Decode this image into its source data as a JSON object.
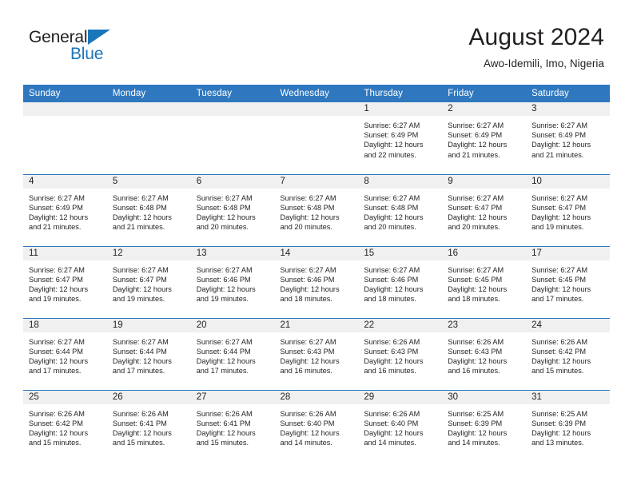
{
  "brand": {
    "name_top": "General",
    "name_bottom": "Blue",
    "triangle_color": "#1b75bb"
  },
  "header": {
    "title": "August 2024",
    "subtitle": "Awo-Idemili, Imo, Nigeria",
    "accent_color": "#2f78bf"
  },
  "weekday_headers": [
    "Sunday",
    "Monday",
    "Tuesday",
    "Wednesday",
    "Thursday",
    "Friday",
    "Saturday"
  ],
  "weeks": [
    [
      {
        "day": "",
        "blank": true,
        "sunrise": "",
        "sunset": "",
        "daylight1": "",
        "daylight2": ""
      },
      {
        "day": "",
        "blank": true,
        "sunrise": "",
        "sunset": "",
        "daylight1": "",
        "daylight2": ""
      },
      {
        "day": "",
        "blank": true,
        "sunrise": "",
        "sunset": "",
        "daylight1": "",
        "daylight2": ""
      },
      {
        "day": "",
        "blank": true,
        "sunrise": "",
        "sunset": "",
        "daylight1": "",
        "daylight2": ""
      },
      {
        "day": "1",
        "blank": false,
        "sunrise": "Sunrise: 6:27 AM",
        "sunset": "Sunset: 6:49 PM",
        "daylight1": "Daylight: 12 hours",
        "daylight2": "and 22 minutes."
      },
      {
        "day": "2",
        "blank": false,
        "sunrise": "Sunrise: 6:27 AM",
        "sunset": "Sunset: 6:49 PM",
        "daylight1": "Daylight: 12 hours",
        "daylight2": "and 21 minutes."
      },
      {
        "day": "3",
        "blank": false,
        "sunrise": "Sunrise: 6:27 AM",
        "sunset": "Sunset: 6:49 PM",
        "daylight1": "Daylight: 12 hours",
        "daylight2": "and 21 minutes."
      }
    ],
    [
      {
        "day": "4",
        "blank": false,
        "sunrise": "Sunrise: 6:27 AM",
        "sunset": "Sunset: 6:49 PM",
        "daylight1": "Daylight: 12 hours",
        "daylight2": "and 21 minutes."
      },
      {
        "day": "5",
        "blank": false,
        "sunrise": "Sunrise: 6:27 AM",
        "sunset": "Sunset: 6:48 PM",
        "daylight1": "Daylight: 12 hours",
        "daylight2": "and 21 minutes."
      },
      {
        "day": "6",
        "blank": false,
        "sunrise": "Sunrise: 6:27 AM",
        "sunset": "Sunset: 6:48 PM",
        "daylight1": "Daylight: 12 hours",
        "daylight2": "and 20 minutes."
      },
      {
        "day": "7",
        "blank": false,
        "sunrise": "Sunrise: 6:27 AM",
        "sunset": "Sunset: 6:48 PM",
        "daylight1": "Daylight: 12 hours",
        "daylight2": "and 20 minutes."
      },
      {
        "day": "8",
        "blank": false,
        "sunrise": "Sunrise: 6:27 AM",
        "sunset": "Sunset: 6:48 PM",
        "daylight1": "Daylight: 12 hours",
        "daylight2": "and 20 minutes."
      },
      {
        "day": "9",
        "blank": false,
        "sunrise": "Sunrise: 6:27 AM",
        "sunset": "Sunset: 6:47 PM",
        "daylight1": "Daylight: 12 hours",
        "daylight2": "and 20 minutes."
      },
      {
        "day": "10",
        "blank": false,
        "sunrise": "Sunrise: 6:27 AM",
        "sunset": "Sunset: 6:47 PM",
        "daylight1": "Daylight: 12 hours",
        "daylight2": "and 19 minutes."
      }
    ],
    [
      {
        "day": "11",
        "blank": false,
        "sunrise": "Sunrise: 6:27 AM",
        "sunset": "Sunset: 6:47 PM",
        "daylight1": "Daylight: 12 hours",
        "daylight2": "and 19 minutes."
      },
      {
        "day": "12",
        "blank": false,
        "sunrise": "Sunrise: 6:27 AM",
        "sunset": "Sunset: 6:47 PM",
        "daylight1": "Daylight: 12 hours",
        "daylight2": "and 19 minutes."
      },
      {
        "day": "13",
        "blank": false,
        "sunrise": "Sunrise: 6:27 AM",
        "sunset": "Sunset: 6:46 PM",
        "daylight1": "Daylight: 12 hours",
        "daylight2": "and 19 minutes."
      },
      {
        "day": "14",
        "blank": false,
        "sunrise": "Sunrise: 6:27 AM",
        "sunset": "Sunset: 6:46 PM",
        "daylight1": "Daylight: 12 hours",
        "daylight2": "and 18 minutes."
      },
      {
        "day": "15",
        "blank": false,
        "sunrise": "Sunrise: 6:27 AM",
        "sunset": "Sunset: 6:46 PM",
        "daylight1": "Daylight: 12 hours",
        "daylight2": "and 18 minutes."
      },
      {
        "day": "16",
        "blank": false,
        "sunrise": "Sunrise: 6:27 AM",
        "sunset": "Sunset: 6:45 PM",
        "daylight1": "Daylight: 12 hours",
        "daylight2": "and 18 minutes."
      },
      {
        "day": "17",
        "blank": false,
        "sunrise": "Sunrise: 6:27 AM",
        "sunset": "Sunset: 6:45 PM",
        "daylight1": "Daylight: 12 hours",
        "daylight2": "and 17 minutes."
      }
    ],
    [
      {
        "day": "18",
        "blank": false,
        "sunrise": "Sunrise: 6:27 AM",
        "sunset": "Sunset: 6:44 PM",
        "daylight1": "Daylight: 12 hours",
        "daylight2": "and 17 minutes."
      },
      {
        "day": "19",
        "blank": false,
        "sunrise": "Sunrise: 6:27 AM",
        "sunset": "Sunset: 6:44 PM",
        "daylight1": "Daylight: 12 hours",
        "daylight2": "and 17 minutes."
      },
      {
        "day": "20",
        "blank": false,
        "sunrise": "Sunrise: 6:27 AM",
        "sunset": "Sunset: 6:44 PM",
        "daylight1": "Daylight: 12 hours",
        "daylight2": "and 17 minutes."
      },
      {
        "day": "21",
        "blank": false,
        "sunrise": "Sunrise: 6:27 AM",
        "sunset": "Sunset: 6:43 PM",
        "daylight1": "Daylight: 12 hours",
        "daylight2": "and 16 minutes."
      },
      {
        "day": "22",
        "blank": false,
        "sunrise": "Sunrise: 6:26 AM",
        "sunset": "Sunset: 6:43 PM",
        "daylight1": "Daylight: 12 hours",
        "daylight2": "and 16 minutes."
      },
      {
        "day": "23",
        "blank": false,
        "sunrise": "Sunrise: 6:26 AM",
        "sunset": "Sunset: 6:43 PM",
        "daylight1": "Daylight: 12 hours",
        "daylight2": "and 16 minutes."
      },
      {
        "day": "24",
        "blank": false,
        "sunrise": "Sunrise: 6:26 AM",
        "sunset": "Sunset: 6:42 PM",
        "daylight1": "Daylight: 12 hours",
        "daylight2": "and 15 minutes."
      }
    ],
    [
      {
        "day": "25",
        "blank": false,
        "sunrise": "Sunrise: 6:26 AM",
        "sunset": "Sunset: 6:42 PM",
        "daylight1": "Daylight: 12 hours",
        "daylight2": "and 15 minutes."
      },
      {
        "day": "26",
        "blank": false,
        "sunrise": "Sunrise: 6:26 AM",
        "sunset": "Sunset: 6:41 PM",
        "daylight1": "Daylight: 12 hours",
        "daylight2": "and 15 minutes."
      },
      {
        "day": "27",
        "blank": false,
        "sunrise": "Sunrise: 6:26 AM",
        "sunset": "Sunset: 6:41 PM",
        "daylight1": "Daylight: 12 hours",
        "daylight2": "and 15 minutes."
      },
      {
        "day": "28",
        "blank": false,
        "sunrise": "Sunrise: 6:26 AM",
        "sunset": "Sunset: 6:40 PM",
        "daylight1": "Daylight: 12 hours",
        "daylight2": "and 14 minutes."
      },
      {
        "day": "29",
        "blank": false,
        "sunrise": "Sunrise: 6:26 AM",
        "sunset": "Sunset: 6:40 PM",
        "daylight1": "Daylight: 12 hours",
        "daylight2": "and 14 minutes."
      },
      {
        "day": "30",
        "blank": false,
        "sunrise": "Sunrise: 6:25 AM",
        "sunset": "Sunset: 6:39 PM",
        "daylight1": "Daylight: 12 hours",
        "daylight2": "and 14 minutes."
      },
      {
        "day": "31",
        "blank": false,
        "sunrise": "Sunrise: 6:25 AM",
        "sunset": "Sunset: 6:39 PM",
        "daylight1": "Daylight: 12 hours",
        "daylight2": "and 13 minutes."
      }
    ]
  ]
}
